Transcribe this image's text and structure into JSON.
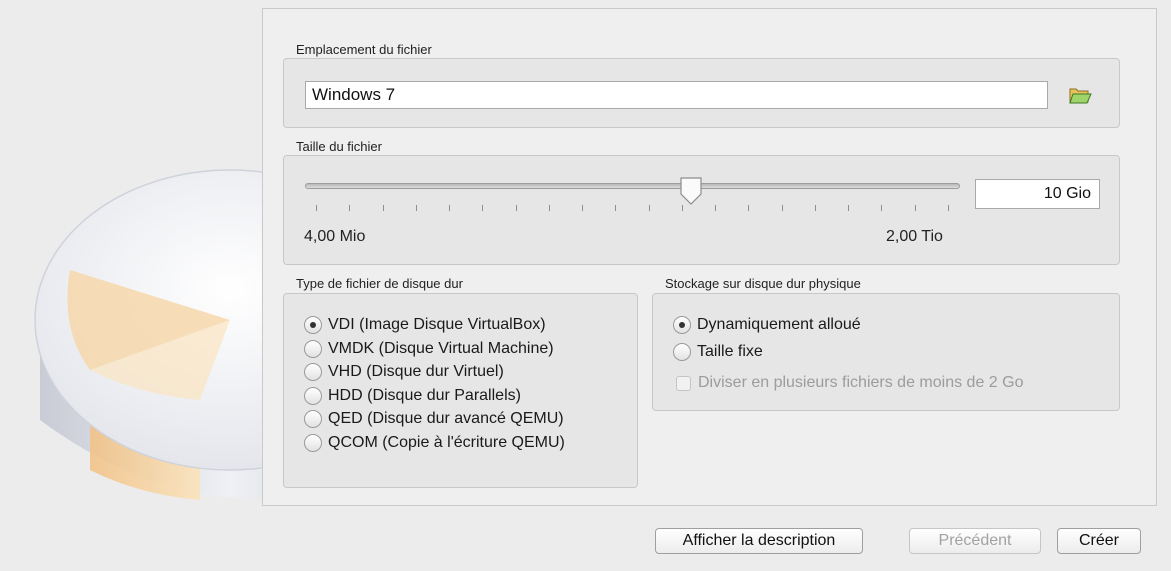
{
  "file_location": {
    "label": "Emplacement du fichier",
    "value": "Windows 7",
    "browse_icon": "folder-open-icon"
  },
  "file_size": {
    "label": "Taille du fichier",
    "value": "10 Gio",
    "min_label": "4,00 Mio",
    "max_label": "2,00 Tio",
    "slider_fraction": 0.59
  },
  "disk_type": {
    "label": "Type de fichier de disque dur",
    "options": [
      {
        "label": "VDI (Image Disque VirtualBox)",
        "selected": true
      },
      {
        "label": "VMDK (Disque Virtual Machine)",
        "selected": false
      },
      {
        "label": "VHD (Disque dur Virtuel)",
        "selected": false
      },
      {
        "label": "HDD (Disque dur Parallels)",
        "selected": false
      },
      {
        "label": "QED (Disque dur avancé QEMU)",
        "selected": false
      },
      {
        "label": "QCOM (Copie à l'écriture QEMU)",
        "selected": false
      }
    ]
  },
  "storage": {
    "label": "Stockage sur disque dur physique",
    "options": [
      {
        "label": "Dynamiquement alloué",
        "selected": true
      },
      {
        "label": "Taille fixe",
        "selected": false
      }
    ],
    "split_checkbox": {
      "label": "Diviser en plusieurs fichiers de moins de 2 Go",
      "checked": false,
      "enabled": false
    }
  },
  "buttons": {
    "describe": "Afficher la description",
    "back": "Précédent",
    "create": "Créer"
  },
  "colors": {
    "window_bg": "#ececec",
    "disk_accent": "#f5c98a"
  }
}
